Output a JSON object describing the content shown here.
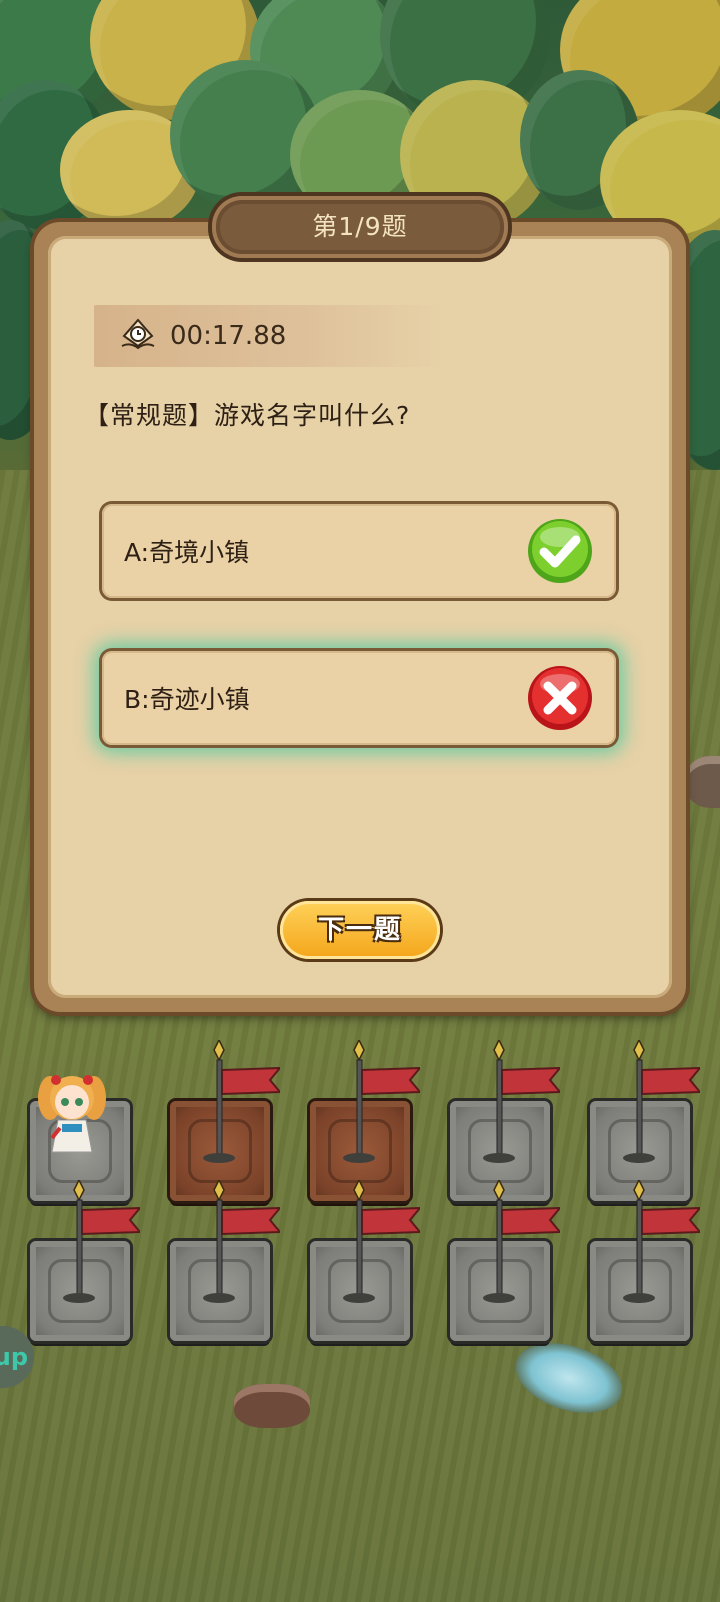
{
  "header": {
    "question_counter": "第1/9题"
  },
  "timer": {
    "icon": "clock-icon",
    "value": "00:17.88"
  },
  "question": {
    "text": "【常规题】游戏名字叫什么?"
  },
  "options": [
    {
      "label": "A:奇境小镇",
      "status": "correct",
      "icon": "check-icon",
      "color": "#5fbf1f"
    },
    {
      "label": "B:奇迹小镇",
      "status": "wrong",
      "icon": "cross-icon",
      "color": "#e0242a"
    }
  ],
  "next_button": {
    "label": "下一题"
  },
  "side_button": {
    "label": "up"
  },
  "board": {
    "rows": [
      [
        "stone",
        "brown",
        "brown",
        "stone",
        "stone"
      ],
      [
        "stone",
        "stone",
        "stone",
        "stone",
        "stone"
      ]
    ]
  },
  "colors": {
    "panel_bg": "#e7d1a7",
    "panel_frame": "#a98356",
    "button_gold": "#f4a51a",
    "flag_red": "#c0343a",
    "highlight_glow": "#46c8a0"
  }
}
